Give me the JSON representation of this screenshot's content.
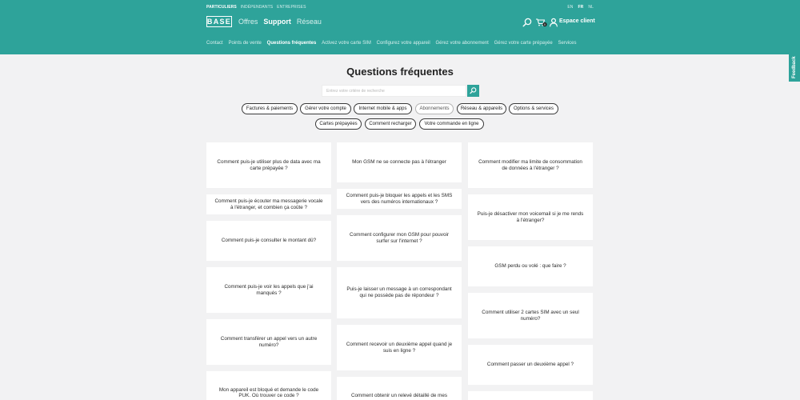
{
  "topbar": {
    "segments": [
      "PARTICULIERS",
      "INDÉPENDANTS",
      "ENTREPRISES"
    ],
    "languages": [
      "EN",
      "FR",
      "NL"
    ]
  },
  "header": {
    "logo": "BASE",
    "nav": [
      "Offres",
      "Support",
      "Réseau"
    ],
    "cart_count": "0",
    "client_label": "Espace client"
  },
  "subnav": [
    "Contact",
    "Points de vente",
    "Questions fréquentes",
    "Activez votre carte SIM",
    "Configurez votre appareil",
    "Gérez votre abonnement",
    "Gérez votre carte prépayée",
    "Services"
  ],
  "feedback_label": "Feedback",
  "page": {
    "title": "Questions fréquentes",
    "search_placeholder": "Entrez votre critère de recherche"
  },
  "filters_row1": [
    "Factures & paiements",
    "Gérer votre compte",
    "Internet mobile & apps",
    "Abonnements",
    "Réseau & appareils",
    "Options & services"
  ],
  "filters_row2": [
    "Cartes prépayées",
    "Comment recharger",
    "Votre commande en ligne"
  ],
  "faq": {
    "col1": [
      "Comment puis-je utiliser plus de data avec ma carte prépayée ?",
      "Comment puis-je écouter ma messagerie vocale à l'étranger, et combien ça coûte ?",
      "Comment puis-je consulter le montant dû?",
      "Comment puis-je voir les appels que j'ai manqués ?",
      "Comment transférer un appel vers un autre numéro?",
      "Mon appareil est bloqué et demande le code PUK. Où trouver ce code ?"
    ],
    "col2": [
      "Mon GSM ne se connecte pas à l'étranger",
      "Comment puis-je bloquer les appels et les SMS vers des numéros internationaux ?",
      "Comment configurer mon GSM pour pouvoir surfer sur l'internet ?",
      "Puis-je laisser un message à un correspondant qui ne possède pas de répondeur ?",
      "Comment recevoir un deuxième appel quand je suis en ligne ?",
      "Comment obtenir un relevé détaillé de mes"
    ],
    "col3": [
      "Comment modifier ma limite de consommation de données à l'étranger ?",
      "Puis-je désactiver mon voicemail si je me rends à l'étranger?",
      "GSM perdu ou volé : que faire ?",
      "Comment utiliser 2 cartes SIM avec un seul numéro?",
      "Comment passer un deuxième appel ?",
      ""
    ]
  },
  "colors": {
    "brand": "#2ea39a",
    "background": "#f2f2f3",
    "card": "#ffffff"
  },
  "icons": [
    "search-icon",
    "cart-icon",
    "user-icon"
  ]
}
